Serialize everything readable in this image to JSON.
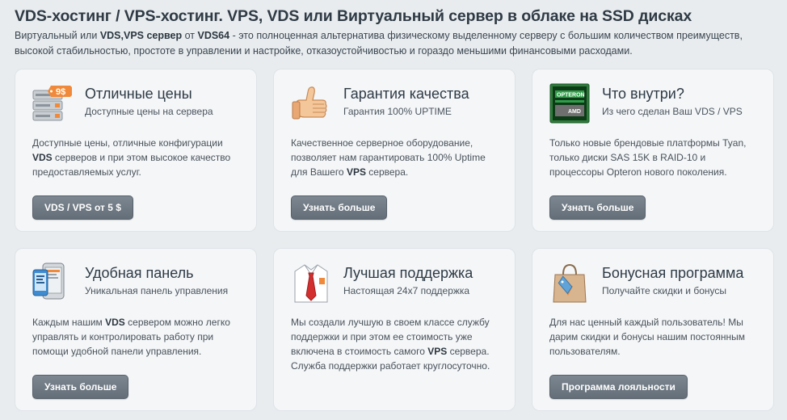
{
  "header": {
    "title": "VDS-хостинг / VPS-хостинг. VPS, VDS или Виртуальный сервер в облаке на SSD дисках",
    "intro": {
      "p1": "Виртуальный или ",
      "b1": "VDS,VPS сервер",
      "p2": " от ",
      "b2": "VDS64",
      "p3": " - это полноценная альтернатива физическому выделенному серверу с большим количеством преимуществ, высокой стабильностью, простоте в управлении и настройке, отказоустойчивостью и гораздо меньшими финансовыми расходами."
    }
  },
  "cards": [
    {
      "icon": "price-server-icon",
      "price_tag": "9$",
      "title": "Отличные цены",
      "subtitle": "Доступные цены на сервера",
      "desc": {
        "p1": "Доступные цены, отличные конфигурации ",
        "b1": "VDS",
        "p2": " серверов и при этом высокое качество предоставляемых услуг."
      },
      "button": "VDS / VPS от 5 $"
    },
    {
      "icon": "thumbs-up-icon",
      "title": "Гарантия качества",
      "subtitle": "Гарантия 100% UPTIME",
      "desc": {
        "p1": "Качественное серверное оборудование, позволяет нам гарантировать 100% Uptime для Вашего ",
        "b1": "VPS",
        "p2": " сервера."
      },
      "button": "Узнать больше"
    },
    {
      "icon": "opteron-chip-icon",
      "chip_brand": "OPTERON",
      "chip_vendor": "AMD",
      "title": "Что внутри?",
      "subtitle": "Из чего сделан Ваш VDS / VPS",
      "desc": {
        "p1": "Только новые брендовые платформы Tyan, только диски SAS 15K в RAID-10 и процессоры Opteron нового поколения.",
        "b1": "",
        "p2": ""
      },
      "button": "Узнать больше"
    },
    {
      "icon": "mobile-devices-icon",
      "title": "Удобная панель",
      "subtitle": "Уникальная панель управления",
      "desc": {
        "p1": "Каждым нашим ",
        "b1": "VDS",
        "p2": " сервером можно легко управлять и контролировать работу при помощи удобной панели управления."
      },
      "button": "Узнать больше"
    },
    {
      "icon": "shirt-tie-icon",
      "title": "Лучшая поддержка",
      "subtitle": "Настоящая 24х7 поддержка",
      "desc": {
        "p1": "Мы создали лучшую в своем классе службу поддержки и при этом ее стоимость уже включена в стоимость самого ",
        "b1": "VPS",
        "p2": " сервера. Служба поддержки работает круглосуточно."
      },
      "button": ""
    },
    {
      "icon": "shopping-bag-icon",
      "title": "Бонусная программа",
      "subtitle": "Получайте скидки и бонусы",
      "desc": {
        "p1": "Для нас ценный каждый пользователь! Мы дарим скидки и бонусы нашим постоянным пользователям.",
        "b1": "",
        "p2": ""
      },
      "button": "Программа лояльности"
    }
  ],
  "colors": {
    "background": "#e8ecef",
    "card": "#f4f6f8",
    "button": "#6c7680",
    "accent_orange": "#f08a3a"
  }
}
